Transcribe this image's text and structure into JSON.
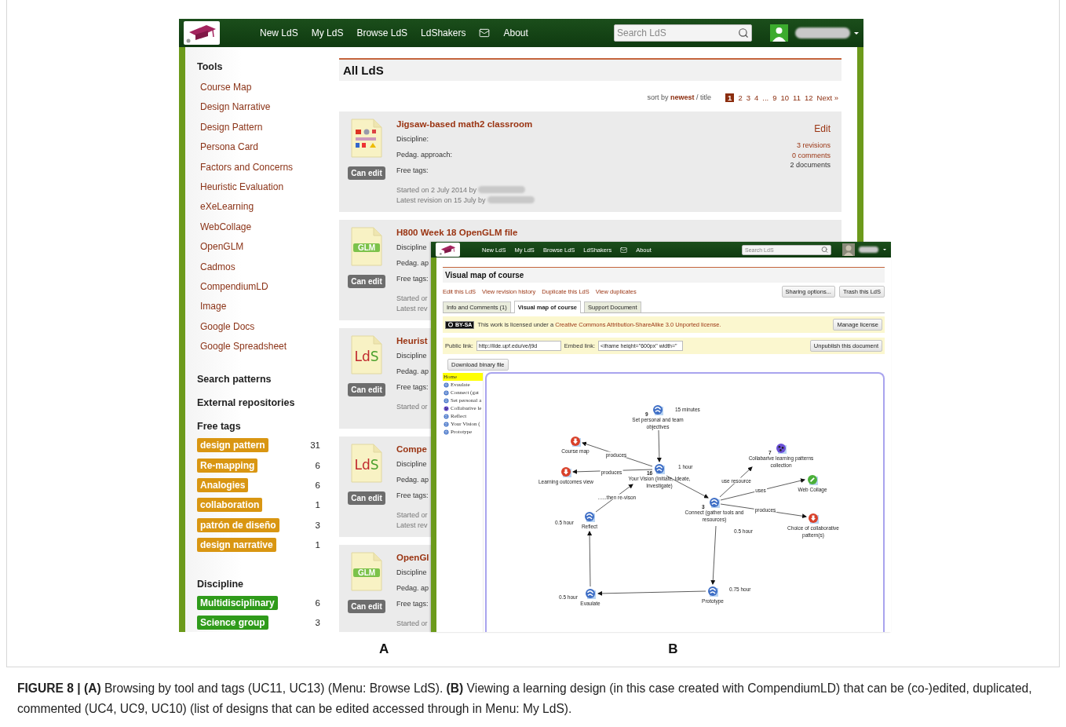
{
  "screen_a": {
    "nav": [
      {
        "kind": "link",
        "label": "New LdS"
      },
      {
        "kind": "link",
        "label": "My LdS"
      },
      {
        "kind": "link",
        "label": "Browse LdS"
      },
      {
        "kind": "link",
        "label": "LdShakers"
      },
      {
        "kind": "mail"
      },
      {
        "kind": "link",
        "label": "About"
      }
    ],
    "search": {
      "placeholder": "Search LdS"
    },
    "sidebar": {
      "tools_heading": "Tools",
      "tools": [
        "Course Map",
        "Design Narrative",
        "Design Pattern",
        "Persona Card",
        "Factors and Concerns",
        "Heuristic Evaluation",
        "eXeLearning",
        "WebCollage",
        "OpenGLM",
        "Cadmos",
        "CompendiumLD",
        "Image",
        "Google Docs",
        "Google Spreadsheet"
      ],
      "search_patterns": "Search patterns",
      "external_repositories": "External repositories",
      "free_tags_heading": "Free tags",
      "free_tags": [
        {
          "label": "design pattern",
          "count": "31"
        },
        {
          "label": "Re-mapping",
          "count": "6"
        },
        {
          "label": "Analogies",
          "count": "6"
        },
        {
          "label": "collaboration",
          "count": "1"
        },
        {
          "label": "patrón de diseño",
          "count": "3"
        },
        {
          "label": "design narrative",
          "count": "1"
        }
      ],
      "discipline_heading": "Discipline",
      "disciplines": [
        {
          "label": "Multidisciplinary",
          "count": "6"
        },
        {
          "label": "Science group",
          "count": "3"
        }
      ]
    },
    "main": {
      "title": "All LdS",
      "sort": "sort by **newest** / title",
      "pages": [
        {
          "label": "1",
          "selected": true
        },
        {
          "label": "2",
          "selected": false
        },
        {
          "label": "3",
          "selected": false
        },
        {
          "label": "4",
          "selected": false
        },
        {
          "label": "...",
          "selected": false
        },
        {
          "label": "9",
          "selected": false
        },
        {
          "label": "10",
          "selected": false
        },
        {
          "label": "11",
          "selected": false
        },
        {
          "label": "12",
          "selected": false
        },
        {
          "label": "Next »",
          "selected": false
        }
      ],
      "cards": [
        {
          "title": "Jigsaw-based math2 classroom",
          "kind": "collage",
          "badge": "Can edit",
          "fields": [
            "Discipline:",
            "Pedag. approach:",
            "Free tags:"
          ],
          "byline": [
            {
              "text": "Started on 2 July 2014 by",
              "redacted": true
            },
            {
              "text": "Latest revision on 15 July by",
              "redacted": true
            }
          ],
          "edit": "Edit",
          "stats": [
            {
              "label": "3 revisions",
              "kind": "link"
            },
            {
              "label": "0 comments",
              "kind": "link"
            },
            {
              "label": "2 documents",
              "kind": "text"
            }
          ]
        },
        {
          "title": "H800 Week 18 OpenGLM file",
          "kind": "glm",
          "icon_text": "GLM",
          "badge": "Can edit",
          "fields": [
            "Discipline",
            "Pedag. ap",
            "Free tags:"
          ],
          "byline": [
            {
              "text": "Started or",
              "redacted": false
            },
            {
              "text": "Latest rev",
              "redacted": false
            }
          ]
        },
        {
          "title": "Heurist",
          "kind": "lds",
          "icon_text": "LdS",
          "badge": "Can edit",
          "fields": [
            "Discipline",
            "Pedag. ap",
            "Free tags:"
          ],
          "byline": [
            {
              "text": "Started or",
              "redacted": false
            }
          ]
        },
        {
          "title": "Compe",
          "kind": "lds",
          "icon_text": "LdS",
          "badge": "Can edit",
          "fields": [
            "Discipline",
            "Pedag. ap",
            "Free tags:"
          ],
          "byline": [
            {
              "text": "Started or",
              "redacted": false
            },
            {
              "text": "Latest rev",
              "redacted": false
            }
          ]
        },
        {
          "title": "OpenGl",
          "kind": "glm",
          "icon_text": "GLM",
          "badge": "Can edit",
          "fields": [
            "Discipline",
            "Pedag. ap",
            "Free tags:"
          ],
          "byline": [
            {
              "text": "Started or",
              "redacted": false
            }
          ]
        }
      ]
    }
  },
  "screen_b": {
    "nav": [
      {
        "kind": "link",
        "label": "New LdS"
      },
      {
        "kind": "link",
        "label": "My LdS"
      },
      {
        "kind": "link",
        "label": "Browse LdS"
      },
      {
        "kind": "link",
        "label": "LdShakers"
      },
      {
        "kind": "mail"
      },
      {
        "kind": "link",
        "label": "About"
      }
    ],
    "search": {
      "placeholder": "Search LdS"
    },
    "title": "Visual map of course",
    "actions": [
      "Edit this LdS",
      "View revision history",
      "Duplicate this LdS",
      "View duplicates"
    ],
    "buttons": [
      "Sharing options...",
      "Trash this LdS"
    ],
    "tabs": [
      {
        "label": "Info and Comments (1)",
        "selected": false
      },
      {
        "label": "Visual map of course",
        "selected": true
      },
      {
        "label": "Support Document",
        "selected": false
      }
    ],
    "license": {
      "badge": "BY-SA",
      "text": "This work is licensed under a ",
      "link": "Creative Commons Attribution-ShareAlike 3.0 Unported license.",
      "button": "Manage license"
    },
    "links": {
      "public_label": "Public link:",
      "public_value": "http://ilde.upf.edu/ve/j9d",
      "embed_label": "Embed link:",
      "embed_value": "<iframe height=\"600px\" width=\"",
      "button": "Unpublish this document"
    },
    "download": "Download binary file",
    "tree": [
      {
        "label": "Home",
        "kind": "home",
        "selected": true
      },
      {
        "label": "Evaulate",
        "kind": "activity",
        "selected": false
      },
      {
        "label": "Connect (gat",
        "kind": "activity",
        "selected": false
      },
      {
        "label": "Set personal a",
        "kind": "activity",
        "selected": false
      },
      {
        "label": "Collabarive le",
        "kind": "resource",
        "selected": false
      },
      {
        "label": "Reflect",
        "kind": "activity",
        "selected": false
      },
      {
        "label": "Your Vision (",
        "kind": "activity",
        "selected": false
      },
      {
        "label": "Prototype",
        "kind": "activity",
        "selected": false
      }
    ],
    "map": {
      "nodes": [
        {
          "label": "Set personal and team objectives",
          "kind": "activity",
          "count": "9",
          "duration": "15 minutes"
        },
        {
          "label": "Course map",
          "kind": "output"
        },
        {
          "label": "Learning outcomes view",
          "kind": "output"
        },
        {
          "label": "Your Vision (Initiate, Ideate, Investigate)",
          "kind": "activity",
          "count": "16",
          "duration": "1 hour"
        },
        {
          "label": "Connect (gather tools and resources)",
          "kind": "activity",
          "count": "3",
          "duration": "0.5 hour"
        },
        {
          "label": "Collabarive learning patterns collection",
          "kind": "resource",
          "count": "7"
        },
        {
          "label": "Web Collage",
          "kind": "tool"
        },
        {
          "label": "Choice of collaborative pattern(s)",
          "kind": "output"
        },
        {
          "label": "Reflect",
          "kind": "activity",
          "duration": "0.5 hour"
        },
        {
          "label": "Evaulate",
          "kind": "activity",
          "duration": "0.5 hour"
        },
        {
          "label": "Prototype",
          "kind": "activity",
          "duration": "0.75 hour"
        }
      ],
      "edge_labels": [
        "produces",
        "produces",
        "......then re-vison",
        "use resource",
        "uses",
        "produces"
      ]
    }
  },
  "panel_labels": [
    "A",
    "B"
  ],
  "caption": "**FIGURE 8 | (A)** Browsing by tool and tags (UC11, UC13) (Menu: Browse LdS). **(B)** Viewing a learning design (in this case created with CompendiumLD) that can be (co-)edited, duplicated, commented (UC4, UC9, UC10) (list of designs that can be edited accessed through in Menu: My LdS)."
}
